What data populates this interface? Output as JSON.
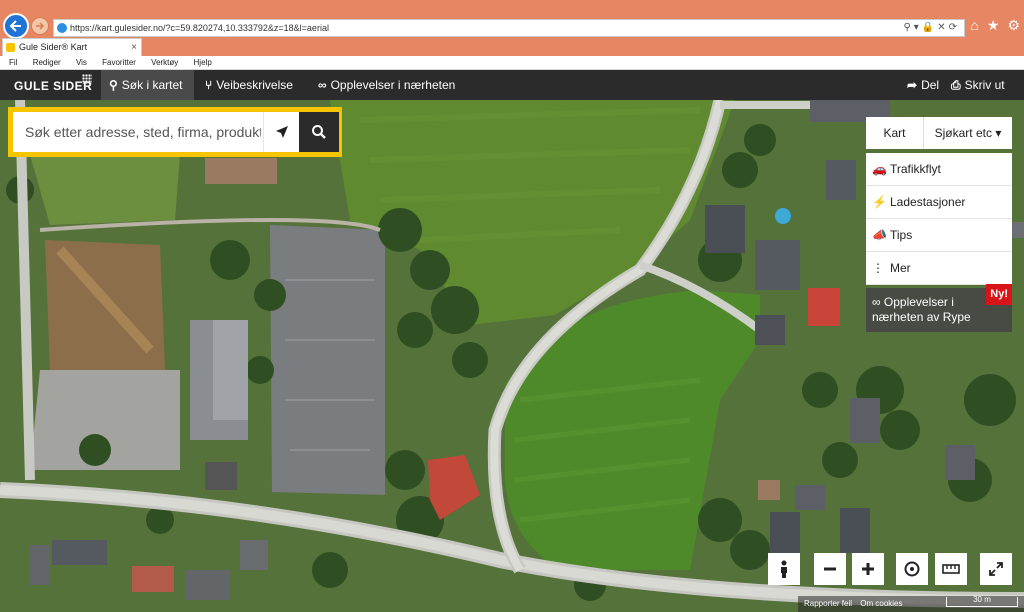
{
  "browser": {
    "url": "https://kart.gulesider.no/?c=59.820274,10.333792&z=18&l=aerial",
    "tab_title": "Gule Sider® Kart",
    "tab_close": "×",
    "menu": [
      "Fil",
      "Rediger",
      "Vis",
      "Favoritter",
      "Verktøy",
      "Hjelp"
    ]
  },
  "header": {
    "logo": "GULE SIDER",
    "nav": {
      "search": "Søk i kartet",
      "route": "Veibeskrivelse",
      "experiences": "Opplevelser i nærheten",
      "share": "Del",
      "print": "Skriv ut"
    }
  },
  "search": {
    "placeholder": "Søk etter adresse, sted, firma, produkt"
  },
  "map_type": {
    "kart": "Kart",
    "selected": "Sjøkart etc"
  },
  "layers": [
    {
      "label": "Trafikkflyt",
      "icon": "car-icon"
    },
    {
      "label": "Ladestasjoner",
      "icon": "charging-icon"
    },
    {
      "label": "Tips",
      "icon": "megaphone-icon"
    },
    {
      "label": "Mer",
      "icon": "more-icon"
    }
  ],
  "experience_panel": {
    "text": "Opplevelser i nærheten av Rype",
    "badge": "Ny!"
  },
  "footer": {
    "report": "Rapporter feil",
    "about_cookies": "Om cookies",
    "scale": "30 m"
  },
  "colors": {
    "brand_yellow": "#f6c500",
    "header_dark": "#2b2b2b",
    "badge_red": "#d8141a"
  }
}
